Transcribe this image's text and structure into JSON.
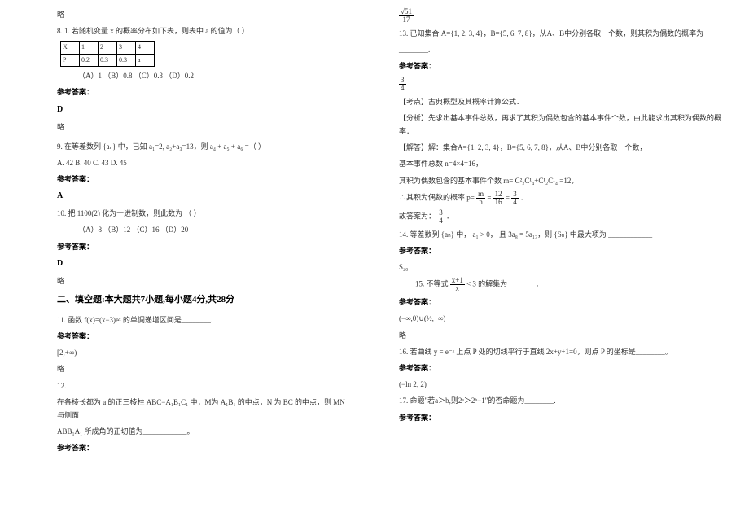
{
  "left": {
    "skip1": "略",
    "q8": {
      "stem_a": "8. 1. 若随机变量 x 的概率分布如下表，则表中 a 的值为（   ）",
      "table": {
        "row1": [
          "X",
          "1",
          "2",
          "3",
          "4"
        ],
        "row2": [
          "P",
          "0.2",
          "0.3",
          "0.3",
          "a"
        ]
      },
      "opts": "（A）1    （B）0.8    （C）0.3    （D）0.2",
      "ans_label": "参考答案：",
      "ans": "D",
      "skip": "略"
    },
    "q9": {
      "stem1": "9. 在等差数列 {aₙ} 中，已知 a₁=2, a₂+a₃=13，则 a₄ + a₅ + a₆ =（    ）",
      "opts": "A. 42          B. 40          C. 43          D. 45",
      "ans_label": "参考答案：",
      "ans": "A"
    },
    "q10": {
      "stem": "10. 把 1100(2) 化为十进制数，则此数为    （    ）",
      "opts": "（A）8               （B）12               （C）16               （D）20",
      "ans_label": "参考答案：",
      "ans": "D",
      "skip": "略"
    },
    "sec2": "二、填空题:本大题共7小题,每小题4分,共28分",
    "q11": {
      "stem": "11. 函数 f(x)=(x−3)eˣ 的单调递增区间是________.",
      "ans_label": "参考答案：",
      "ans": "[2,+∞)",
      "skip": "略"
    },
    "q12": {
      "num": "12.",
      "line1a": "在各棱长都为 a 的正三棱柱 ABC−A₁B₁C₁ 中，M为 A₁B₁ 的中点，N 为 BC 的中点，则 MN 与侧面",
      "line2": "ABB₁A₁ 所成角的正切值为____________。",
      "ans_label": "参考答案："
    }
  },
  "right": {
    "q12ans": {
      "top": "√51",
      "bot": "17"
    },
    "q13": {
      "stem1": "13. 已知集合 A={1, 2, 3, 4}，B={5, 6, 7, 8}，从A、B中分别各取一个数，则其积为偶数的概率为",
      "blank": "________.",
      "ans_label": "参考答案：",
      "frac": {
        "n": "3",
        "d": "4"
      },
      "kdian": "【考点】古典概型及其概率计算公式．",
      "fenxi": "【分析】先求出基本事件总数，再求了其积为偶数包含的基本事件个数，由此能求出其积为偶数的概率．",
      "jie1": "【解答】解：集合A={1, 2, 3, 4}，B={5, 6, 7, 8}，从A、B中分别各取一个数，",
      "jie2": "基本事件总数 n=4×4=16，",
      "jie3a": "其积为偶数包含的基本事件个数 m=",
      "jie3b": "=12，",
      "jie4a": "∴其积为偶数的概率 p=",
      "jie4frac1": {
        "n": "m",
        "d": "n"
      },
      "jie4eq": "=",
      "jie4frac2": {
        "n": "12",
        "d": "16"
      },
      "jie4frac3": {
        "n": "3",
        "d": "4"
      },
      "jie4dot": "．",
      "jie5a": "故答案为：",
      "jie5dot": "．"
    },
    "combo": "C²₂C¹₄+C¹₂C¹₄",
    "q14": {
      "stem": "14. 等差数列 {aₙ} 中，",
      "mid": "a₁ > 0，",
      "cond": "且 3a₈ = 5a₁₃，则 {Sₙ} 中最大项为 ____________",
      "ans_label": "参考答案：",
      "ans": "S₂₀"
    },
    "q15": {
      "stem_a": "15. 不等式",
      "frac": {
        "n": "x+1",
        "d": "x"
      },
      "stem_b": " < 3 的解集为________.",
      "ans_label": "参考答案：",
      "ans": "(−∞,0)∪(½,+∞)",
      "skip": "略"
    },
    "q16": {
      "stem": "16. 若曲线 y = e⁻ˣ 上点 P 处的切线平行于直线 2x+y+1=0，则点 P 的坐标是________。",
      "ans_label": "参考答案：",
      "ans": "(−ln 2, 2)"
    },
    "q17": {
      "stem": "17. 命题\"若a＞b,则2ᵃ＞2ᵇ−1\"的否命题为________.",
      "ans_label": "参考答案："
    }
  }
}
